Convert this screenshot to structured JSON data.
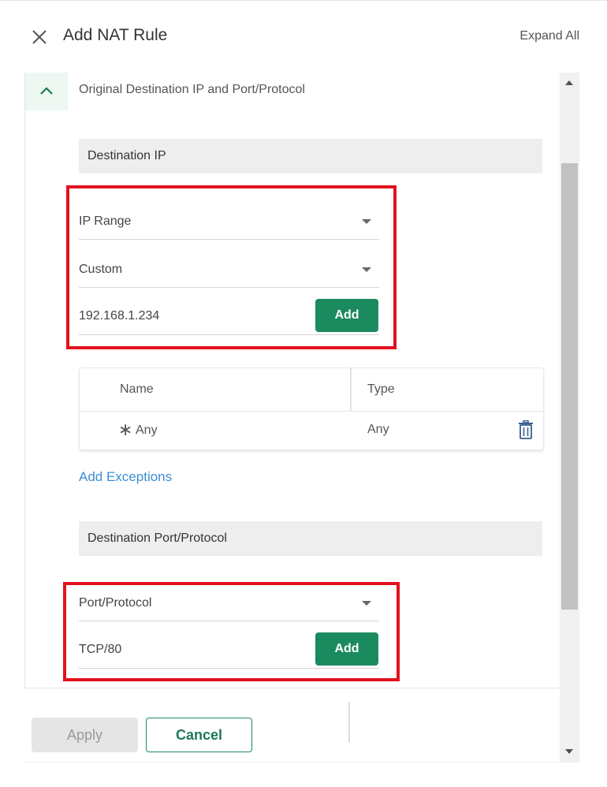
{
  "header": {
    "title": "Add NAT Rule",
    "expand_all_label": "Expand All",
    "close_icon": "close-icon"
  },
  "section": {
    "title": "Original Destination IP and Port/Protocol",
    "toggle_icon": "chevron-up-icon"
  },
  "destination_ip": {
    "header": "Destination IP",
    "type_select": "IP Range",
    "mode_select": "Custom",
    "ip_input_value": "192.168.1.234",
    "add_label": "Add"
  },
  "ip_table": {
    "columns": [
      "Name",
      "Type"
    ],
    "rows": [
      {
        "icon": "asterisk-icon",
        "name": "Any",
        "type": "Any",
        "action_icon": "trash-icon"
      }
    ]
  },
  "add_exceptions_label": "Add Exceptions",
  "destination_port": {
    "header": "Destination Port/Protocol",
    "type_select": "Port/Protocol",
    "port_input_value": "TCP/80",
    "add_label": "Add"
  },
  "footer": {
    "apply_label": "Apply",
    "cancel_label": "Cancel"
  },
  "colors": {
    "accent_green": "#1c8a5f",
    "highlight_red": "#e3111e",
    "link_blue": "#3b8ed5"
  }
}
